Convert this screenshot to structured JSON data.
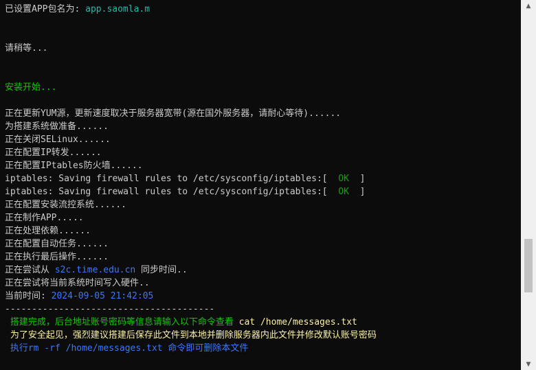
{
  "terminal": {
    "lines": [
      [
        {
          "t": "已设置APP包名为: ",
          "c": "default"
        },
        {
          "t": "app.saomla.m",
          "c": "green"
        }
      ],
      [],
      [],
      [
        {
          "t": "请稍等...",
          "c": "default"
        }
      ],
      [],
      [],
      [
        {
          "t": "安装开始...",
          "c": "lgreen"
        }
      ],
      [],
      [
        {
          "t": "正在更新YUM源，更新速度取决于服务器宽带(源在国外服务器，请耐心等待)......",
          "c": "default"
        }
      ],
      [
        {
          "t": "为搭建系统做准备......",
          "c": "default"
        }
      ],
      [
        {
          "t": "正在关闭SELinux......",
          "c": "default"
        }
      ],
      [
        {
          "t": "正在配置IP转发......",
          "c": "default"
        }
      ],
      [
        {
          "t": "正在配置IPtables防火墙......",
          "c": "default"
        }
      ],
      [
        {
          "t": "iptables: Saving firewall rules to /etc/sysconfig/iptables:[  ",
          "c": "default"
        },
        {
          "t": "OK",
          "c": "ok"
        },
        {
          "t": "  ]",
          "c": "default"
        }
      ],
      [
        {
          "t": "iptables: Saving firewall rules to /etc/sysconfig/iptables:[  ",
          "c": "default"
        },
        {
          "t": "OK",
          "c": "ok"
        },
        {
          "t": "  ]",
          "c": "default"
        }
      ],
      [
        {
          "t": "正在配置安装流控系统......",
          "c": "default"
        }
      ],
      [
        {
          "t": "正在制作APP.....",
          "c": "default"
        }
      ],
      [
        {
          "t": "正在处理依赖......",
          "c": "default"
        }
      ],
      [
        {
          "t": "正在配置自动任务......",
          "c": "default"
        }
      ],
      [
        {
          "t": "正在执行最后操作......",
          "c": "default"
        }
      ],
      [
        {
          "t": "正在尝试从 ",
          "c": "default"
        },
        {
          "t": "s2c.time.edu.cn",
          "c": "blue"
        },
        {
          "t": " 同步时间..",
          "c": "default"
        }
      ],
      [
        {
          "t": "正在尝试将当前系统时间写入硬件..",
          "c": "default"
        }
      ],
      [
        {
          "t": "当前时间: ",
          "c": "default"
        },
        {
          "t": "2024-09-05 21:42:05",
          "c": "blue"
        }
      ],
      [
        {
          "t": "---------------------------------------",
          "c": "default"
        }
      ],
      [
        {
          "t": " 搭建完成，后台地址账号密码等信息请输入以下命令查看 ",
          "c": "lgreen"
        },
        {
          "t": "cat /home/messages.txt",
          "c": "yellow"
        }
      ],
      [
        {
          "t": " 为了安全起见，强烈建议搭建后保存此文件到本地并删除服务器内此文件并修改默认账号密码",
          "c": "yellow"
        }
      ],
      [
        {
          "t": " 执行",
          "c": "blue"
        },
        {
          "t": "rm -rf /home/messages.txt",
          "c": "blue"
        },
        {
          "t": " 命令即可删除本文件",
          "c": "blue"
        }
      ]
    ]
  },
  "scrollbar": {
    "up_icon": "▲",
    "down_icon": "▼",
    "position_fraction": 0.72
  }
}
